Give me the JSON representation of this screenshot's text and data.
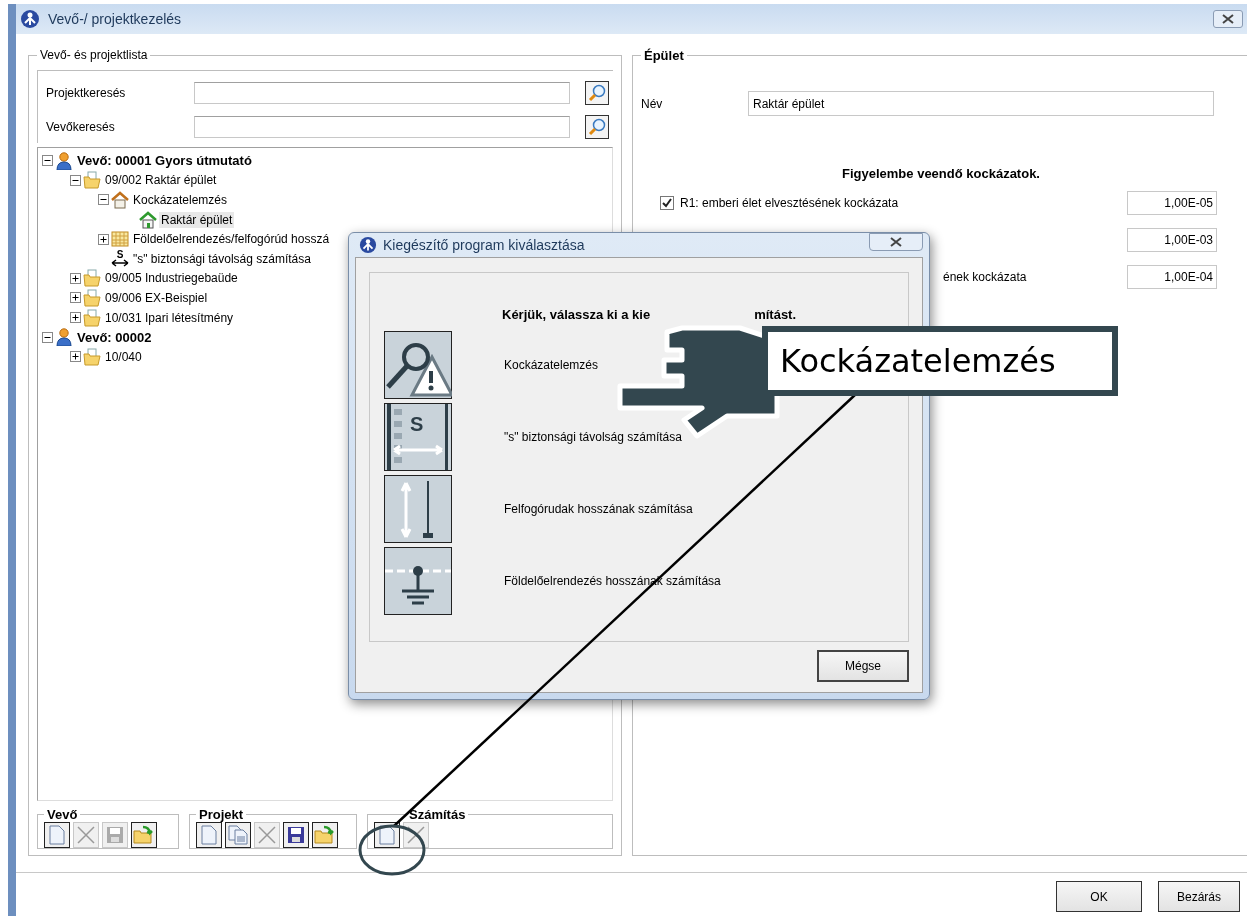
{
  "window": {
    "title": "Vevő-/ projektkezelés"
  },
  "left_panel": {
    "title": "Vevő- és projektlista",
    "searches": [
      {
        "label": "Projektkeresés"
      },
      {
        "label": "Vevőkeresés"
      }
    ],
    "tree": [
      {
        "label": "Vevő: 00001 Gyors útmutató",
        "kind": "customer",
        "expanded": true,
        "selected": false,
        "children": [
          {
            "label": "09/002 Raktár épület",
            "kind": "folder",
            "expanded": true,
            "selected": false,
            "children": [
              {
                "label": "Kockázatelemzés",
                "kind": "house",
                "expanded": true,
                "selected": false,
                "children": [
                  {
                    "label": "Raktár épület",
                    "kind": "building",
                    "selected": true
                  }
                ]
              },
              {
                "label": "Földelőelrendezés/felfogórúd hosszá",
                "kind": "grid",
                "expanded": false,
                "selected": false
              },
              {
                "label": "\"s\" biztonsági távolság számítása",
                "kind": "distance",
                "icon_text": "S",
                "selected": false
              }
            ]
          },
          {
            "label": "09/005 Industriegebaüde",
            "kind": "folder",
            "expanded": false,
            "selected": false
          },
          {
            "label": "09/006 EX-Beispiel",
            "kind": "folder",
            "expanded": false,
            "selected": false
          },
          {
            "label": "10/031 Ipari létesítmény",
            "kind": "folder",
            "expanded": false,
            "selected": false
          }
        ]
      },
      {
        "label": "Vevő: 00002",
        "kind": "customer",
        "expanded": true,
        "selected": false,
        "children": [
          {
            "label": "10/040",
            "kind": "folder",
            "expanded": false,
            "selected": false
          }
        ]
      }
    ],
    "toolbars": [
      {
        "title": "Vevő",
        "buttons": [
          {
            "kind": "new",
            "disabled": false
          },
          {
            "kind": "delete",
            "disabled": true
          },
          {
            "kind": "save",
            "disabled": true
          },
          {
            "kind": "open",
            "disabled": false
          }
        ]
      },
      {
        "title": "Projekt",
        "buttons": [
          {
            "kind": "new",
            "disabled": false
          },
          {
            "kind": "copy",
            "disabled": false
          },
          {
            "kind": "delete",
            "disabled": true
          },
          {
            "kind": "save",
            "disabled": false
          },
          {
            "kind": "open",
            "disabled": false
          }
        ]
      },
      {
        "title": "Számítás",
        "buttons": [
          {
            "kind": "new",
            "disabled": false
          },
          {
            "kind": "delete",
            "disabled": true
          }
        ]
      }
    ]
  },
  "right_panel": {
    "title": "Épület",
    "name_label": "Név",
    "name_value": "Raktár épület",
    "heading": "Figyelembe veendő kockázatok.",
    "risks": [
      {
        "checked": true,
        "label": "R1: emberi élet elvesztésének kockázata",
        "value": "1,00E-05"
      },
      {
        "value": "1,00E-03"
      },
      {
        "label": "ének kockázata",
        "value": "1,00E-04"
      }
    ]
  },
  "buttons": [
    {
      "label": "OK"
    },
    {
      "label": "Bezárás"
    }
  ],
  "dialog": {
    "title": "Kiegészítő program kiválasztása",
    "heading_parts": [
      "Kérjük, válassza ki a kie",
      "mítást."
    ],
    "options": [
      {
        "kind": "risk",
        "label": "Kockázatelemzés"
      },
      {
        "kind": "distance",
        "icon_text": "S",
        "label": "\"s\" biztonsági távolság számítása"
      },
      {
        "kind": "rod",
        "label": "Felfogórudak hosszának számítása"
      },
      {
        "kind": "earth",
        "label": "Földelőelrendezés hosszának számítása"
      }
    ],
    "cancel": "Mégse"
  },
  "callout": {
    "label": "Kockázatelemzés"
  }
}
